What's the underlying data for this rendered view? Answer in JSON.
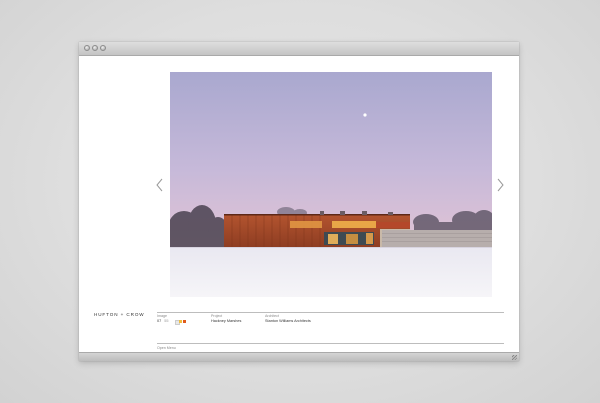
{
  "brand": {
    "logo_text": "HUFTON + CROW"
  },
  "slideshow": {
    "prev_icon": "chevron-left-icon",
    "next_icon": "chevron-right-icon",
    "image_label": "Image",
    "image_current": "07",
    "image_total": "55",
    "image_swatch_colors": [
      "#e8e8e8",
      "#f0c040",
      "#e05a1c"
    ]
  },
  "details": {
    "project_label": "Project",
    "project_value": "Hackney Marshes",
    "architect_label": "Architect",
    "architect_value": "Stanton Williams Architects"
  },
  "footer": {
    "menu_link": "Open Menu"
  },
  "colors": {
    "page_background": "#dcdcdc",
    "window_background": "#ffffff",
    "titlebar": "#cfcfcf",
    "sky_top": "#b0aed2",
    "sky_horizon": "#e0c3d6",
    "snow": "#f4f3f7",
    "building_corten": "#a64a2c"
  }
}
